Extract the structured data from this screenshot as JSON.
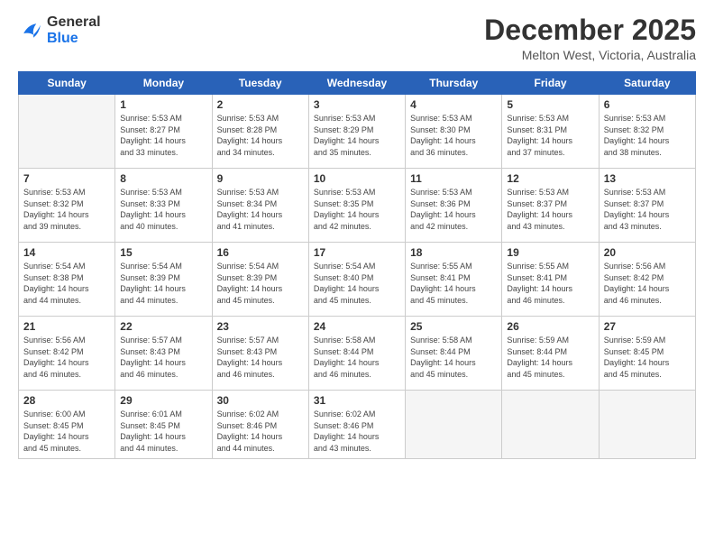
{
  "header": {
    "logo_line1": "General",
    "logo_line2": "Blue",
    "month": "December 2025",
    "location": "Melton West, Victoria, Australia"
  },
  "days_of_week": [
    "Sunday",
    "Monday",
    "Tuesday",
    "Wednesday",
    "Thursday",
    "Friday",
    "Saturday"
  ],
  "weeks": [
    [
      {
        "day": "",
        "info": ""
      },
      {
        "day": "1",
        "info": "Sunrise: 5:53 AM\nSunset: 8:27 PM\nDaylight: 14 hours\nand 33 minutes."
      },
      {
        "day": "2",
        "info": "Sunrise: 5:53 AM\nSunset: 8:28 PM\nDaylight: 14 hours\nand 34 minutes."
      },
      {
        "day": "3",
        "info": "Sunrise: 5:53 AM\nSunset: 8:29 PM\nDaylight: 14 hours\nand 35 minutes."
      },
      {
        "day": "4",
        "info": "Sunrise: 5:53 AM\nSunset: 8:30 PM\nDaylight: 14 hours\nand 36 minutes."
      },
      {
        "day": "5",
        "info": "Sunrise: 5:53 AM\nSunset: 8:31 PM\nDaylight: 14 hours\nand 37 minutes."
      },
      {
        "day": "6",
        "info": "Sunrise: 5:53 AM\nSunset: 8:32 PM\nDaylight: 14 hours\nand 38 minutes."
      }
    ],
    [
      {
        "day": "7",
        "info": "Sunrise: 5:53 AM\nSunset: 8:32 PM\nDaylight: 14 hours\nand 39 minutes."
      },
      {
        "day": "8",
        "info": "Sunrise: 5:53 AM\nSunset: 8:33 PM\nDaylight: 14 hours\nand 40 minutes."
      },
      {
        "day": "9",
        "info": "Sunrise: 5:53 AM\nSunset: 8:34 PM\nDaylight: 14 hours\nand 41 minutes."
      },
      {
        "day": "10",
        "info": "Sunrise: 5:53 AM\nSunset: 8:35 PM\nDaylight: 14 hours\nand 42 minutes."
      },
      {
        "day": "11",
        "info": "Sunrise: 5:53 AM\nSunset: 8:36 PM\nDaylight: 14 hours\nand 42 minutes."
      },
      {
        "day": "12",
        "info": "Sunrise: 5:53 AM\nSunset: 8:37 PM\nDaylight: 14 hours\nand 43 minutes."
      },
      {
        "day": "13",
        "info": "Sunrise: 5:53 AM\nSunset: 8:37 PM\nDaylight: 14 hours\nand 43 minutes."
      }
    ],
    [
      {
        "day": "14",
        "info": "Sunrise: 5:54 AM\nSunset: 8:38 PM\nDaylight: 14 hours\nand 44 minutes."
      },
      {
        "day": "15",
        "info": "Sunrise: 5:54 AM\nSunset: 8:39 PM\nDaylight: 14 hours\nand 44 minutes."
      },
      {
        "day": "16",
        "info": "Sunrise: 5:54 AM\nSunset: 8:39 PM\nDaylight: 14 hours\nand 45 minutes."
      },
      {
        "day": "17",
        "info": "Sunrise: 5:54 AM\nSunset: 8:40 PM\nDaylight: 14 hours\nand 45 minutes."
      },
      {
        "day": "18",
        "info": "Sunrise: 5:55 AM\nSunset: 8:41 PM\nDaylight: 14 hours\nand 45 minutes."
      },
      {
        "day": "19",
        "info": "Sunrise: 5:55 AM\nSunset: 8:41 PM\nDaylight: 14 hours\nand 46 minutes."
      },
      {
        "day": "20",
        "info": "Sunrise: 5:56 AM\nSunset: 8:42 PM\nDaylight: 14 hours\nand 46 minutes."
      }
    ],
    [
      {
        "day": "21",
        "info": "Sunrise: 5:56 AM\nSunset: 8:42 PM\nDaylight: 14 hours\nand 46 minutes."
      },
      {
        "day": "22",
        "info": "Sunrise: 5:57 AM\nSunset: 8:43 PM\nDaylight: 14 hours\nand 46 minutes."
      },
      {
        "day": "23",
        "info": "Sunrise: 5:57 AM\nSunset: 8:43 PM\nDaylight: 14 hours\nand 46 minutes."
      },
      {
        "day": "24",
        "info": "Sunrise: 5:58 AM\nSunset: 8:44 PM\nDaylight: 14 hours\nand 46 minutes."
      },
      {
        "day": "25",
        "info": "Sunrise: 5:58 AM\nSunset: 8:44 PM\nDaylight: 14 hours\nand 45 minutes."
      },
      {
        "day": "26",
        "info": "Sunrise: 5:59 AM\nSunset: 8:44 PM\nDaylight: 14 hours\nand 45 minutes."
      },
      {
        "day": "27",
        "info": "Sunrise: 5:59 AM\nSunset: 8:45 PM\nDaylight: 14 hours\nand 45 minutes."
      }
    ],
    [
      {
        "day": "28",
        "info": "Sunrise: 6:00 AM\nSunset: 8:45 PM\nDaylight: 14 hours\nand 45 minutes."
      },
      {
        "day": "29",
        "info": "Sunrise: 6:01 AM\nSunset: 8:45 PM\nDaylight: 14 hours\nand 44 minutes."
      },
      {
        "day": "30",
        "info": "Sunrise: 6:02 AM\nSunset: 8:46 PM\nDaylight: 14 hours\nand 44 minutes."
      },
      {
        "day": "31",
        "info": "Sunrise: 6:02 AM\nSunset: 8:46 PM\nDaylight: 14 hours\nand 43 minutes."
      },
      {
        "day": "",
        "info": ""
      },
      {
        "day": "",
        "info": ""
      },
      {
        "day": "",
        "info": ""
      }
    ]
  ]
}
